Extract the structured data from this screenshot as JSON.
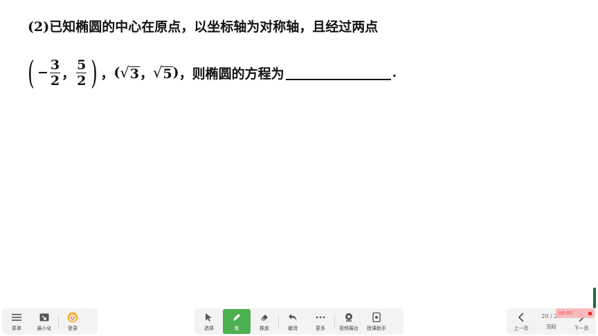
{
  "question": {
    "line1": "(2)已知椭圆的中心在原点，以坐标轴为对称轴，且经过两点",
    "paren_open": "(",
    "paren_close": ")",
    "minus": "−",
    "frac1_num": "3",
    "frac1_den": "2",
    "comma1": "，",
    "frac2_num": "5",
    "frac2_den": "2",
    "comma2": "，",
    "p2_open": "(",
    "sqrt_sign": "√",
    "sqrt1": "3",
    "comma3": "，",
    "sqrt2": "5",
    "p2_close": ")",
    "comma4": "，",
    "tail_text": "则椭圆的方程为",
    "period": "."
  },
  "left_toolbar": {
    "menu": "菜单",
    "minimize": "最小化",
    "login": "登录"
  },
  "center_toolbar": {
    "select": "选择",
    "pen": "笔",
    "eraser": "橡皮",
    "undo": "撤消",
    "more": "更多",
    "video": "视频展台",
    "assistant": "授课助手"
  },
  "right_toolbar": {
    "prev": "上一页",
    "page_info": "20 / 28",
    "pages": "页码",
    "next": "下一页"
  },
  "recorder": {
    "time": "00:00"
  },
  "colors": {
    "active": "#4caf50",
    "toolbar_bg": "#f3f3f3",
    "record": "#e02020"
  }
}
